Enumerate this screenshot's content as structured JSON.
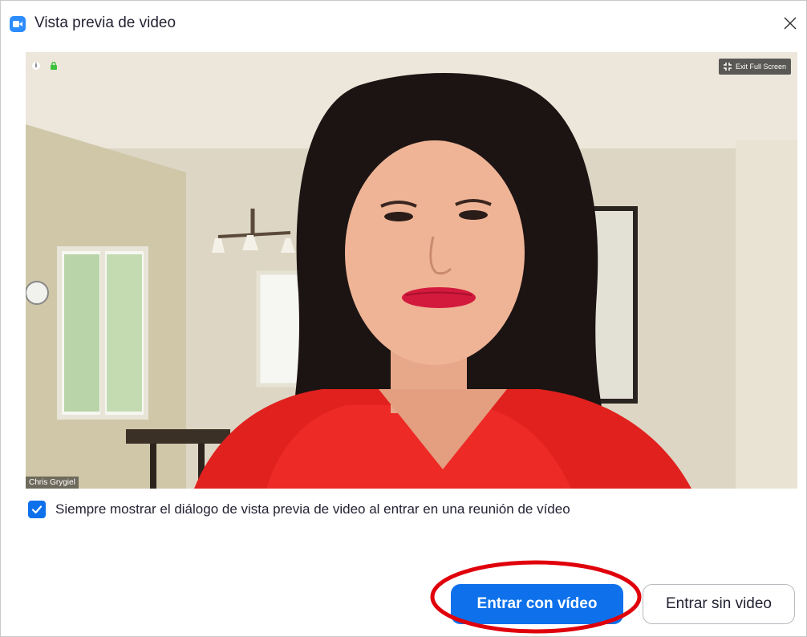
{
  "window": {
    "title": "Vista previa de video",
    "icons": {
      "app": "zoom-video-icon",
      "close": "close-icon"
    }
  },
  "video": {
    "exit_fullscreen_label": "Exit Full Screen",
    "participant_name": "Chris Grygiel",
    "icons": [
      "info-icon",
      "lock-icon",
      "exit-fullscreen-icon"
    ]
  },
  "options": {
    "always_show_preview_label": "Siempre mostrar el diálogo de vista previa de video al entrar en una reunión de vídeo",
    "always_show_preview_checked": true
  },
  "actions": {
    "join_with_video_label": "Entrar con vídeo",
    "join_without_video_label": "Entrar sin video"
  },
  "colors": {
    "accent": "#0e71eb",
    "highlight_ring": "#e0000b"
  }
}
